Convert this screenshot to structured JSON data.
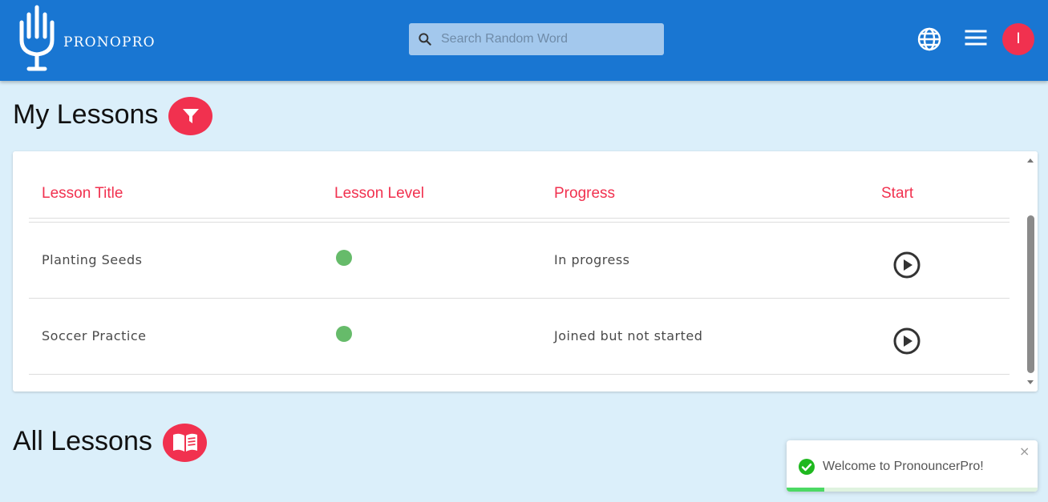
{
  "header": {
    "brand": "PRONOPRO",
    "search_placeholder": "Search Random Word",
    "avatar_initial": "I",
    "colors": {
      "bar": "#1976d2",
      "accent": "#f1314f"
    }
  },
  "my_lessons": {
    "title": "My Lessons",
    "columns": [
      "Lesson Title",
      "Lesson Level",
      "Progress",
      "Start"
    ],
    "rows": [
      {
        "title": "Planting Seeds",
        "level_color": "#66bb6a",
        "progress": "In progress"
      },
      {
        "title": "Soccer Practice",
        "level_color": "#66bb6a",
        "progress": "Joined but not started"
      }
    ]
  },
  "all_lessons": {
    "title": "All Lessons"
  },
  "toast": {
    "message": "Welcome to PronouncerPro!",
    "close_symbol": "×",
    "progress_fraction": 0.15
  }
}
